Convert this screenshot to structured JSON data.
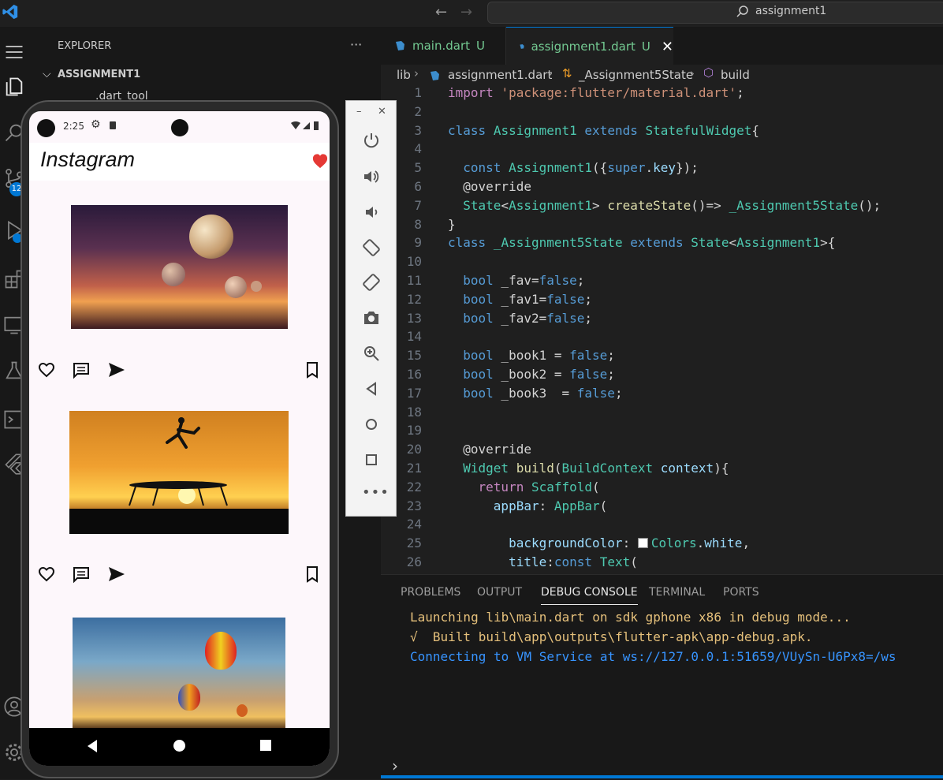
{
  "window": {
    "search_text": "assignment1"
  },
  "explorer": {
    "header": "EXPLORER",
    "more": "···",
    "root": "ASSIGNMENT1",
    "first_item": ".dart_tool"
  },
  "activity": {
    "scm_badge": "12"
  },
  "tabs": [
    {
      "label": "main.dart",
      "status": "U"
    },
    {
      "label": "assignment1.dart",
      "status": "U"
    }
  ],
  "breadcrumb": [
    "lib",
    "assignment1.dart",
    "_Assignment5State",
    "build"
  ],
  "code_lines": [
    "import 'package:flutter/material.dart';",
    "",
    "class Assignment1 extends StatefulWidget{",
    "",
    "  const Assignment1({super.key});",
    "  @override",
    "  State<Assignment1> createState()=> _Assignment5State();",
    "}",
    "class _Assignment5State extends State<Assignment1>{",
    "",
    "  bool _fav=false;",
    "  bool _fav1=false;",
    "  bool _fav2=false;",
    "",
    "  bool _book1 = false;",
    "  bool _book2 = false;",
    "  bool _book3  = false;",
    "",
    "",
    "  @override",
    "  Widget build(BuildContext context){",
    "    return Scaffold(",
    "      appBar: AppBar(",
    "",
    "        backgroundColor:  Colors.white,",
    "        title:const Text("
  ],
  "panel": {
    "tabs": [
      "PROBLEMS",
      "OUTPUT",
      "DEBUG CONSOLE",
      "TERMINAL",
      "PORTS"
    ],
    "active_tab": "DEBUG CONSOLE",
    "console": [
      {
        "text": "Launching lib\\main.dart on sdk gphone x86 in debug mode...",
        "color": "#e5c07b"
      },
      {
        "text": "√  Built build\\app\\outputs\\flutter-apk\\app-debug.apk.",
        "color": "#e5c07b"
      },
      {
        "text": "Connecting to VM Service at ws://127.0.0.1:51659/VUySn-U6Px8=/ws",
        "color": "#3794ff"
      }
    ],
    "prompt": "›"
  },
  "phone": {
    "time": "2:25",
    "app_title": "Instagram",
    "posts": [
      {
        "image": "planets-sunset"
      },
      {
        "image": "trampoline-silhouette"
      },
      {
        "image": "hot-air-balloons"
      }
    ]
  },
  "colors": {
    "accent": "#0078d4",
    "heart": "#e53935"
  }
}
